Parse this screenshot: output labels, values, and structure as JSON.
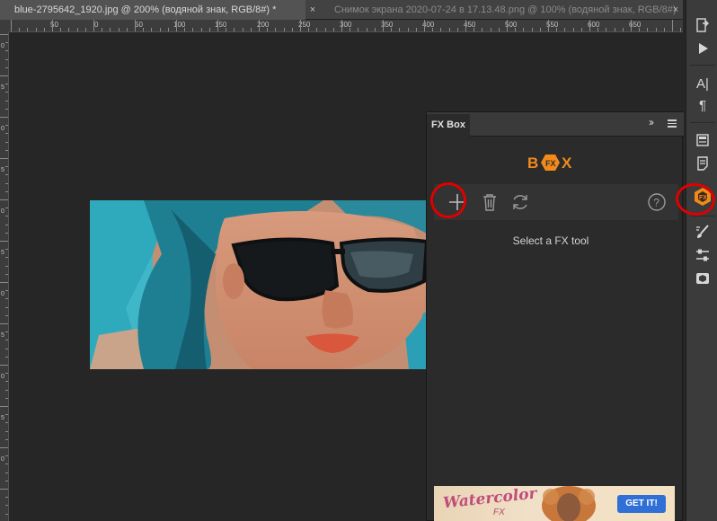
{
  "tabs": [
    {
      "label": "blue-2795642_1920.jpg @ 200% (водяной знак, RGB/8#) *",
      "close": "×"
    },
    {
      "label": "Снимок экрана 2020-07-24 в 17.13.48.png @ 100% (водяной знак, RGB/8#)",
      "close": "×"
    }
  ],
  "ruler": {
    "h_labels": [
      "50",
      "0",
      "50",
      "100",
      "150",
      "200",
      "250",
      "300",
      "350",
      "400",
      "450",
      "500",
      "550",
      "600",
      "650"
    ],
    "v_labels": [
      "0",
      "5",
      "0",
      "5",
      "0",
      "5",
      "0",
      "5",
      "0",
      "5",
      "0"
    ]
  },
  "panel": {
    "title": "FX Box",
    "collapse": "››",
    "logo_text": "BOX",
    "status": "Select a FX tool",
    "tools": {
      "add": "add-icon",
      "delete": "trash-icon",
      "refresh": "refresh-icon",
      "help": "help-icon"
    },
    "banner": {
      "title": "Watercolor",
      "subtitle": "FX",
      "button": "GET IT!"
    }
  },
  "right_toolbar": {
    "items": [
      "history-icon",
      "play-icon",
      "character-icon",
      "paragraph-icon",
      "properties-icon",
      "notes-icon",
      "fxbox-icon",
      "brush-icon",
      "adjustments-icon",
      "3d-icon"
    ],
    "char_glyph": "A|",
    "para_glyph": "¶"
  },
  "colors": {
    "accent": "#f28a1a",
    "highlight": "#e00000",
    "panel_bg": "#2b2b2b",
    "banner_button": "#2f6fd6"
  }
}
